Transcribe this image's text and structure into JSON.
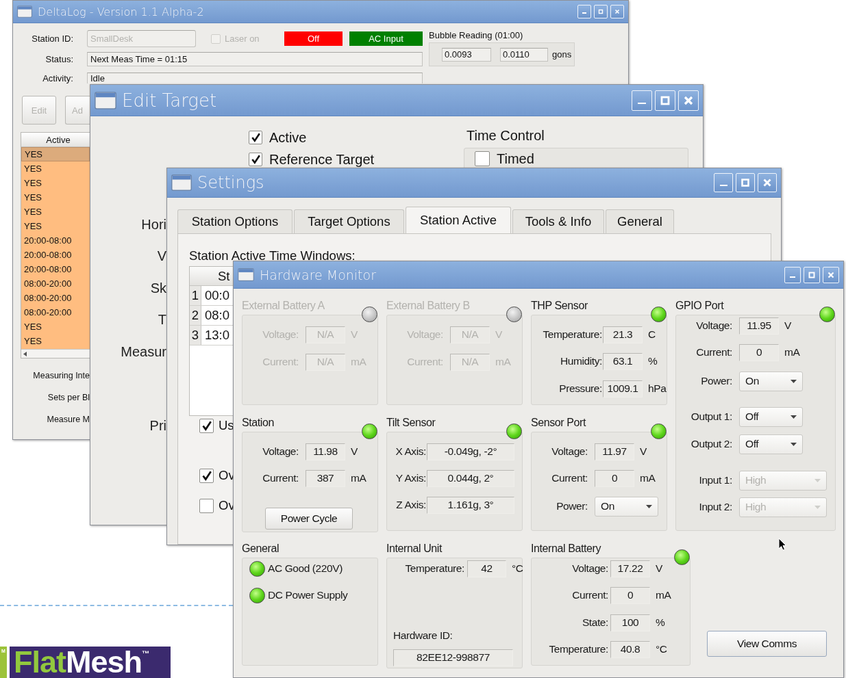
{
  "desktop": {
    "edge_fragment": "M",
    "logo": {
      "parts": [
        "Flat",
        "Mesh"
      ],
      "trademark": "™"
    }
  },
  "deltalog_window": {
    "title": "DeltaLog - Version 1.1 Alpha-2",
    "station_id": {
      "label": "Station ID:",
      "value": "SmallDesk",
      "disabled": true
    },
    "laser": {
      "label": "Laser on",
      "checked": false,
      "disabled": true
    },
    "indicators": [
      {
        "text": "Off",
        "color": "#ff0000"
      },
      {
        "text": "AC Input",
        "color": "#008000"
      }
    ],
    "bubble_reading": {
      "title": "Bubble Reading (01:00)",
      "values": [
        "0.0093",
        "0.0110"
      ],
      "unit": "gons"
    },
    "status": {
      "label": "Status:",
      "value": "Next Meas Time = 01:15"
    },
    "activity": {
      "label": "Activity:",
      "value": "Idle"
    },
    "buttons": [
      {
        "label": "Edit",
        "disabled": true
      },
      {
        "label": "Ad",
        "disabled": true
      }
    ],
    "table": {
      "columns": [
        "Active"
      ],
      "rows": [
        {
          "cells": [
            "YES"
          ],
          "selected": true
        },
        {
          "cells": [
            "YES"
          ],
          "selected": false
        },
        {
          "cells": [
            "YES"
          ],
          "selected": false
        },
        {
          "cells": [
            "YES"
          ],
          "selected": false
        },
        {
          "cells": [
            "YES"
          ],
          "selected": false
        },
        {
          "cells": [
            "YES"
          ],
          "selected": false
        },
        {
          "cells": [
            "20:00-08:00"
          ],
          "selected": false
        },
        {
          "cells": [
            "20:00-08:00"
          ],
          "selected": false
        },
        {
          "cells": [
            "20:00-08:00"
          ],
          "selected": false
        },
        {
          "cells": [
            "08:00-20:00"
          ],
          "selected": false
        },
        {
          "cells": [
            "08:00-20:00"
          ],
          "selected": false
        },
        {
          "cells": [
            "08:00-20:00"
          ],
          "selected": false
        },
        {
          "cells": [
            "YES"
          ],
          "selected": false
        },
        {
          "cells": [
            "YES"
          ],
          "selected": false
        }
      ]
    },
    "labels": [
      "Measuring Inte",
      "Sets per Bl",
      "Measure M"
    ]
  },
  "edit_target_window": {
    "title": "Edit Target",
    "checkboxes": [
      {
        "label": "Active",
        "checked": true
      },
      {
        "label": "Reference Target",
        "checked": true
      }
    ],
    "time_control": {
      "title": "Time Control",
      "checkbox": {
        "label": "Timed",
        "checked": false
      }
    },
    "labels": [
      "Hori",
      "V",
      "Sk",
      "T",
      "Measur",
      "Pri"
    ]
  },
  "settings_window": {
    "title": "Settings",
    "tabs": [
      {
        "label": "Station Options",
        "selected": false
      },
      {
        "label": "Target Options",
        "selected": false
      },
      {
        "label": "Station Active",
        "selected": true
      },
      {
        "label": "Tools & Info",
        "selected": false
      },
      {
        "label": "General",
        "selected": false
      }
    ],
    "section_title": "Station Active Time Windows:",
    "table": {
      "columns": [
        "St"
      ],
      "rows": [
        {
          "number": "1",
          "cells": [
            "00:0"
          ]
        },
        {
          "number": "2",
          "cells": [
            "08:0"
          ]
        },
        {
          "number": "3",
          "cells": [
            "13:0"
          ]
        }
      ]
    },
    "checkboxes": [
      {
        "label": "Us",
        "checked": true
      },
      {
        "label": "Ov",
        "checked": true
      },
      {
        "label": "Ov",
        "checked": false
      }
    ]
  },
  "hardware_monitor": {
    "title": "Hardware Monitor",
    "groups": [
      {
        "title": "External Battery A",
        "disabled": true,
        "indicator_on": false,
        "rows": [
          {
            "kind": "reading",
            "label": "Voltage:",
            "value": "N/A",
            "unit": "V"
          },
          {
            "kind": "reading",
            "label": "Current:",
            "value": "N/A",
            "unit": "mA"
          }
        ]
      },
      {
        "title": "External Battery B",
        "disabled": true,
        "indicator_on": false,
        "rows": [
          {
            "kind": "reading",
            "label": "Voltage:",
            "value": "N/A",
            "unit": "V"
          },
          {
            "kind": "reading",
            "label": "Current:",
            "value": "N/A",
            "unit": "mA"
          }
        ]
      },
      {
        "title": "THP Sensor",
        "disabled": false,
        "indicator_on": true,
        "rows": [
          {
            "kind": "reading",
            "label": "Temperature:",
            "value": "21.3",
            "unit": "C"
          },
          {
            "kind": "reading",
            "label": "Humidity:",
            "value": "63.1",
            "unit": "%"
          },
          {
            "kind": "reading",
            "label": "Pressure:",
            "value": "1009.1",
            "unit": "hPa"
          }
        ]
      },
      {
        "title": "GPIO Port",
        "disabled": false,
        "indicator_on": true,
        "rows": [
          {
            "kind": "reading",
            "label": "Voltage:",
            "value": "11.95",
            "unit": "V"
          },
          {
            "kind": "reading",
            "label": "Current:",
            "value": "0",
            "unit": "mA"
          },
          {
            "kind": "dropdown",
            "label": "Power:",
            "value": "On",
            "disabled": false
          },
          {
            "kind": "dropdown",
            "label": "Output 1:",
            "value": "Off",
            "disabled": false
          },
          {
            "kind": "dropdown",
            "label": "Output 2:",
            "value": "Off",
            "disabled": false
          },
          {
            "kind": "dropdown",
            "label": "Input 1:",
            "value": "High",
            "disabled": true
          },
          {
            "kind": "dropdown",
            "label": "Input 2:",
            "value": "High",
            "disabled": true
          }
        ]
      },
      {
        "title": "Station",
        "disabled": false,
        "indicator_on": true,
        "rows": [
          {
            "kind": "reading",
            "label": "Voltage:",
            "value": "11.98",
            "unit": "V"
          },
          {
            "kind": "reading",
            "label": "Current:",
            "value": "387",
            "unit": "mA"
          },
          {
            "kind": "button",
            "label": "Power Cycle"
          }
        ]
      },
      {
        "title": "Tilt Sensor",
        "disabled": false,
        "indicator_on": true,
        "rows": [
          {
            "kind": "reading",
            "label": "X Axis:",
            "value": "-0.049g, -2°"
          },
          {
            "kind": "reading",
            "label": "Y Axis:",
            "value": "0.044g, 2°"
          },
          {
            "kind": "reading",
            "label": "Z Axis:",
            "value": "1.161g, 3°"
          }
        ]
      },
      {
        "title": "Sensor Port",
        "disabled": false,
        "indicator_on": true,
        "rows": [
          {
            "kind": "reading",
            "label": "Voltage:",
            "value": "11.97",
            "unit": "V"
          },
          {
            "kind": "reading",
            "label": "Current:",
            "value": "0",
            "unit": "mA"
          },
          {
            "kind": "dropdown",
            "label": "Power:",
            "value": "On",
            "disabled": false
          }
        ]
      },
      {
        "title": "General",
        "disabled": false,
        "rows": [
          {
            "kind": "status_light",
            "label": "AC Good (220V)",
            "on": true
          },
          {
            "kind": "status_light",
            "label": "DC Power Supply",
            "on": true
          }
        ]
      },
      {
        "title": "Internal Unit",
        "disabled": false,
        "rows": [
          {
            "kind": "reading",
            "label": "Temperature:",
            "value": "42",
            "unit": "°C"
          },
          {
            "kind": "caption",
            "label": "Hardware ID:"
          },
          {
            "kind": "field",
            "value": "82EE12-998877"
          }
        ]
      },
      {
        "title": "Internal Battery",
        "disabled": false,
        "indicator_on": true,
        "rows": [
          {
            "kind": "reading",
            "label": "Voltage:",
            "value": "17.22",
            "unit": "V"
          },
          {
            "kind": "reading",
            "label": "Current:",
            "value": "0",
            "unit": "mA"
          },
          {
            "kind": "reading",
            "label": "State:",
            "value": "100",
            "unit": "%"
          },
          {
            "kind": "reading",
            "label": "Temperature:",
            "value": "40.8",
            "unit": "°C"
          }
        ]
      }
    ],
    "button": "View Comms"
  }
}
